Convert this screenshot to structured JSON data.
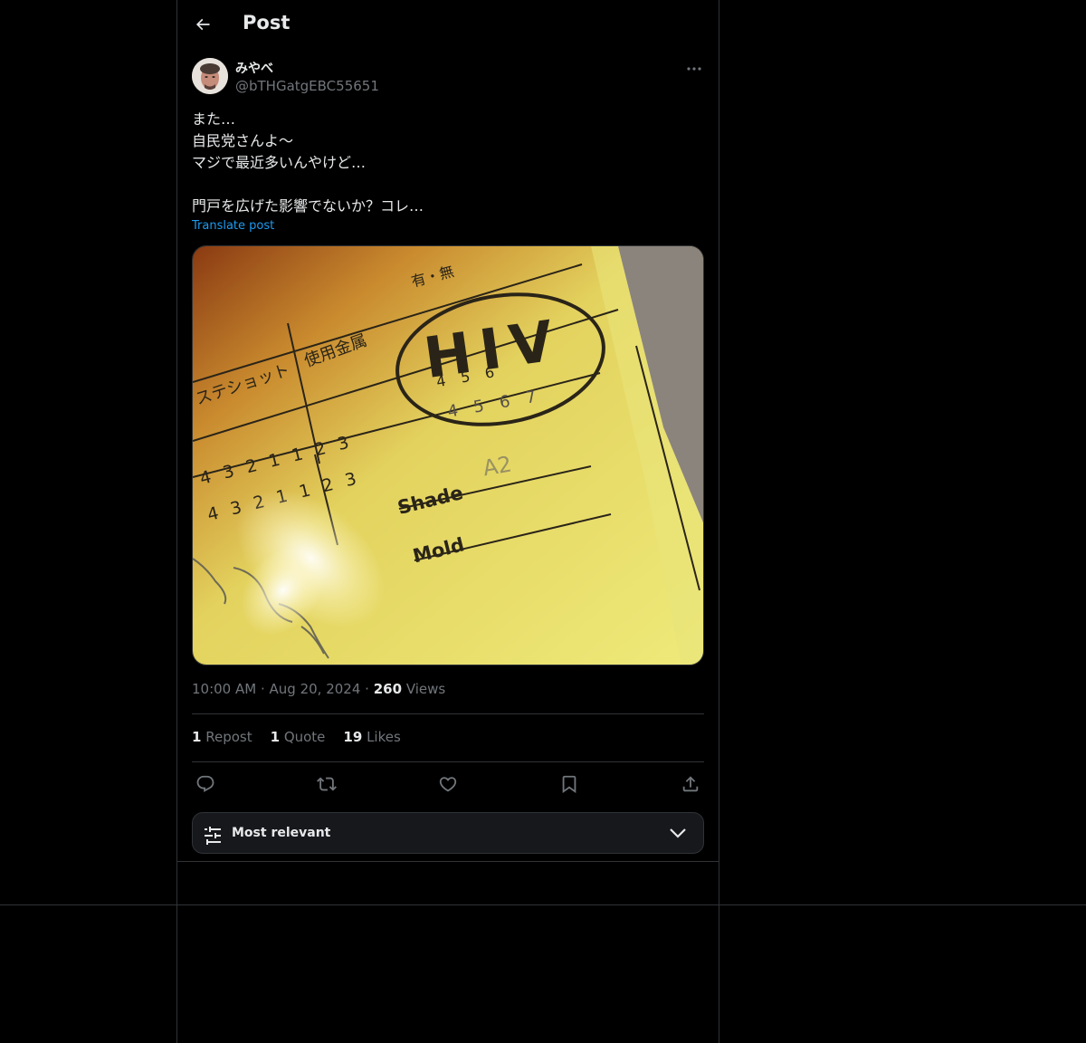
{
  "header": {
    "title": "Post"
  },
  "author": {
    "display_name": "みやべ",
    "handle": "@bTHGatgEBC55651"
  },
  "post": {
    "lines": [
      "また…",
      "自民党さんよ〜",
      "マジで最近多いんやけど…",
      "",
      "門戸を広げた影響でないか？コレ…"
    ],
    "translate_label": "Translate post"
  },
  "media": {
    "image_text": {
      "hiv": "HIV",
      "shade": "Shade",
      "mold": "Mold",
      "metal": "使用金属",
      "stesshot": "ステショット",
      "nums_row1": "4 3 2 1 1 2 3",
      "nums_row2": "4 3 2 1 1 2 3",
      "nums_row3": "4 5 6",
      "nums_row4": "4 5 6 7",
      "a2": "A2",
      "mu": "有・無"
    }
  },
  "meta": {
    "time": "10:00 AM",
    "date": "Aug 20, 2024",
    "views_count": "260",
    "views_label": "Views"
  },
  "stats": {
    "reposts_count": "1",
    "reposts_label": "Repost",
    "quotes_count": "1",
    "quotes_label": "Quote",
    "likes_count": "19",
    "likes_label": "Likes"
  },
  "actions": [
    "reply-icon",
    "repost-icon",
    "like-icon",
    "bookmark-icon",
    "share-icon"
  ],
  "sort": {
    "label": "Most relevant"
  },
  "colors": {
    "background": "#000000",
    "border": "#2f3336",
    "accent": "#1d9bf0",
    "muted": "#71767b"
  }
}
